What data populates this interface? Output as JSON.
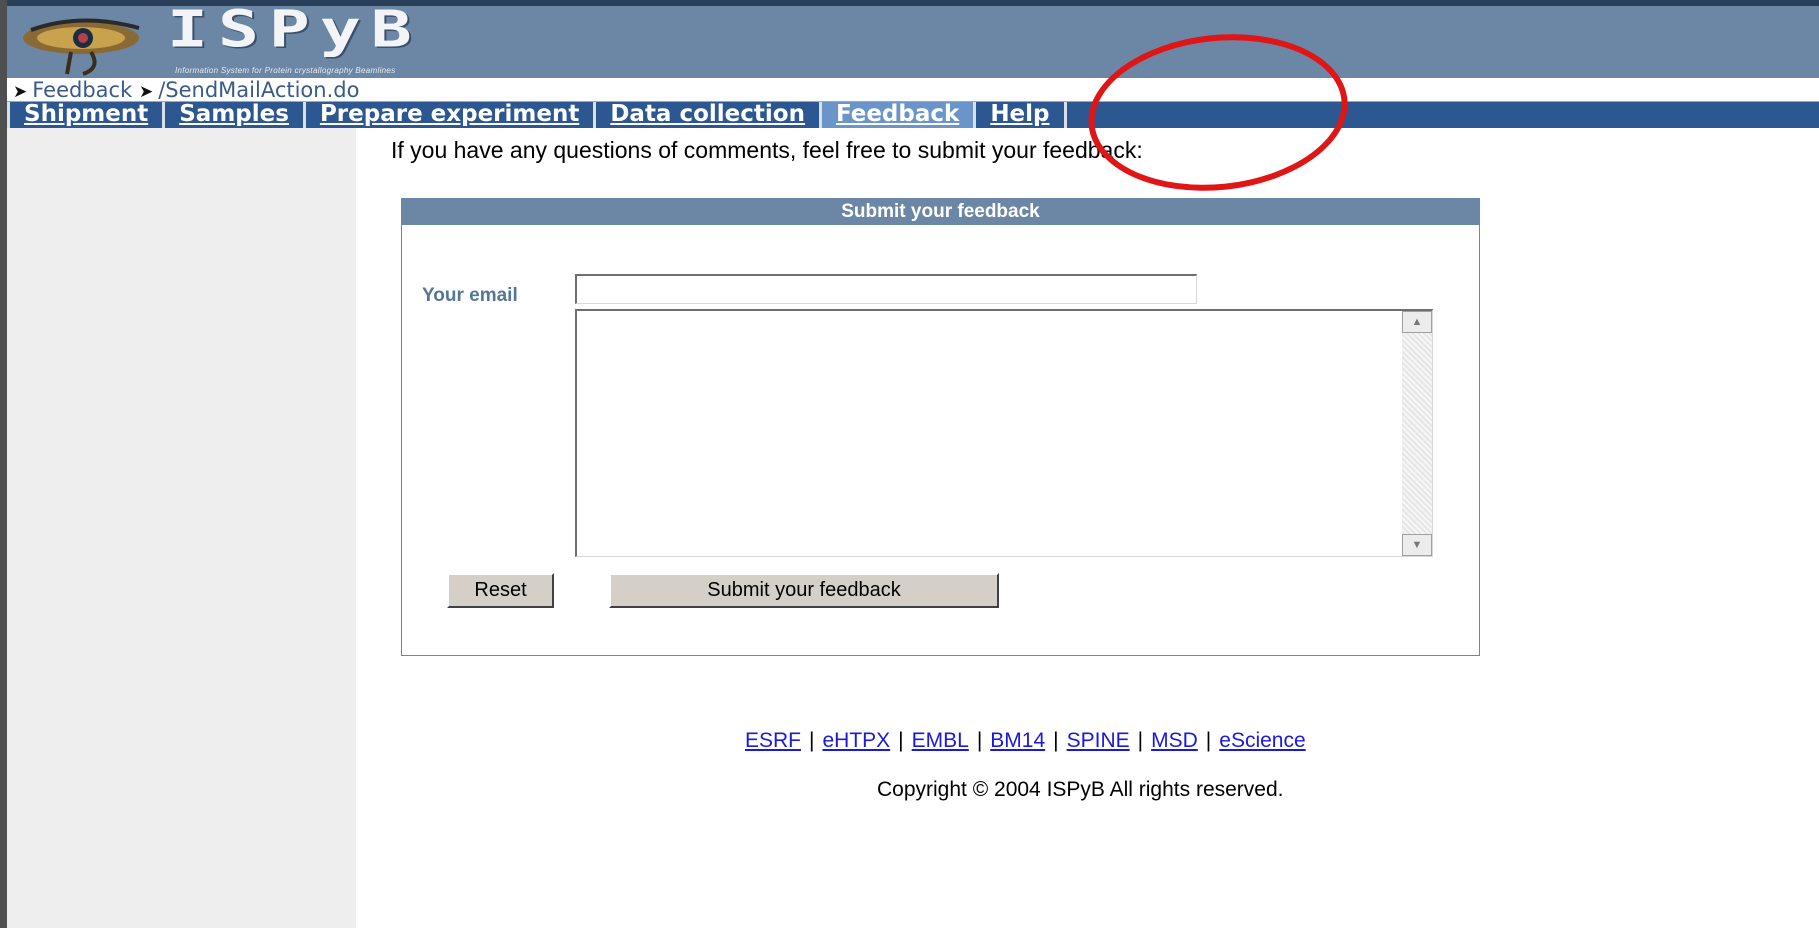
{
  "header": {
    "logo_title": "ISPyB",
    "logo_subtitle": "Information System for Protein crystallography Beamlines"
  },
  "breadcrumb": {
    "items": [
      "Feedback",
      "/SendMailAction.do"
    ]
  },
  "nav": {
    "items": [
      {
        "label": "Shipment",
        "active": false
      },
      {
        "label": "Samples",
        "active": false
      },
      {
        "label": "Prepare experiment",
        "active": false
      },
      {
        "label": "Data collection",
        "active": false
      },
      {
        "label": "Feedback",
        "active": true
      },
      {
        "label": "Help",
        "active": false
      }
    ]
  },
  "main": {
    "intro_text": "If you have any questions of comments, feel free to submit your feedback:"
  },
  "feedback_form": {
    "title": "Submit your feedback",
    "email_label": "Your email",
    "email_value": "",
    "message_value": "",
    "reset_label": "Reset",
    "submit_label": "Submit your feedback"
  },
  "footer": {
    "links": [
      "ESRF",
      "eHTPX",
      "EMBL",
      "BM14",
      "SPINE",
      "MSD",
      "eScience"
    ],
    "separator": "|",
    "copyright": "Copyright © 2004 ISPyB All rights reserved."
  },
  "colors": {
    "header_bg": "#6c86a6",
    "nav_bg": "#2d5791",
    "nav_active_bg": "#6b95c8",
    "annotation_circle": "#e01515",
    "link": "#1a1adb"
  },
  "icons": {
    "logo": "eye-of-horus-icon",
    "breadcrumb_separator": "arrow-right-icon",
    "scroll_up": "triangle-up-icon",
    "scroll_down": "triangle-down-icon"
  }
}
